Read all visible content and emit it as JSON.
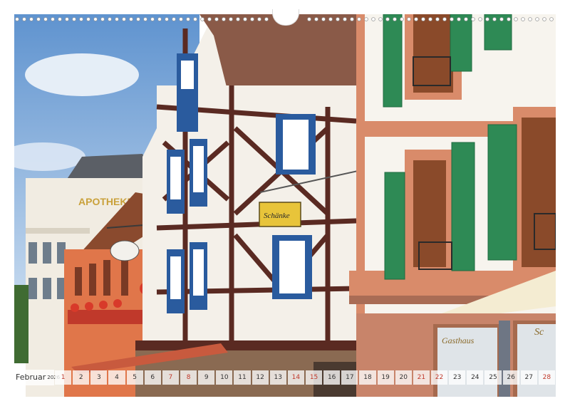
{
  "calendar": {
    "month": "Februar",
    "year": "2026",
    "days": [
      {
        "n": "1",
        "weekend": true
      },
      {
        "n": "2"
      },
      {
        "n": "3"
      },
      {
        "n": "4"
      },
      {
        "n": "5"
      },
      {
        "n": "6"
      },
      {
        "n": "7",
        "weekend": true
      },
      {
        "n": "8",
        "weekend": true
      },
      {
        "n": "9"
      },
      {
        "n": "10"
      },
      {
        "n": "11"
      },
      {
        "n": "12"
      },
      {
        "n": "13"
      },
      {
        "n": "14",
        "weekend": true
      },
      {
        "n": "15",
        "weekend": true
      },
      {
        "n": "16"
      },
      {
        "n": "17"
      },
      {
        "n": "18"
      },
      {
        "n": "19"
      },
      {
        "n": "20"
      },
      {
        "n": "21",
        "weekend": true
      },
      {
        "n": "22",
        "weekend": true
      },
      {
        "n": "23"
      },
      {
        "n": "24"
      },
      {
        "n": "25"
      },
      {
        "n": "26"
      },
      {
        "n": "27"
      },
      {
        "n": "28",
        "weekend": true
      }
    ]
  },
  "signs": {
    "pharmacy": "APOTHEKE",
    "tavern": "Schänke",
    "shop": "Gasthaus",
    "shop_right": "Sc"
  },
  "colors": {
    "sky": "#7fa9d6",
    "timber": "#5a2a22",
    "shutter_blue": "#2a5b9e",
    "shutter_green": "#2e8a55",
    "sandstone": "#d98b6a",
    "sign_yellow": "#e8c43a"
  }
}
